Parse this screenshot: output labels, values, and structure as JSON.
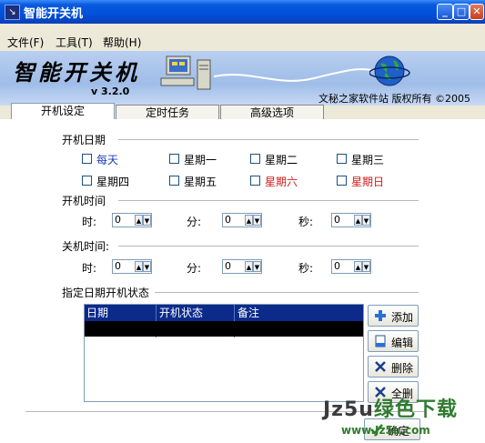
{
  "window": {
    "title": "智能开关机",
    "icon_glyph": "↘",
    "buttons": {
      "min": "_",
      "max": "□",
      "close": "✕"
    }
  },
  "menu": [
    {
      "label": "文件(F)"
    },
    {
      "label": "工具(T)"
    },
    {
      "label": "帮助(H)"
    }
  ],
  "banner": {
    "logo": "智能开关机",
    "version": "v 3.2.0",
    "company": "文秘之家软件站  版权所有  ©2005"
  },
  "tabs": [
    {
      "label": "开机设定",
      "active": true
    },
    {
      "label": "定时任务",
      "active": false
    },
    {
      "label": "高级选项",
      "active": false
    }
  ],
  "startup_days": {
    "label": "开机日期",
    "days": [
      {
        "label": "每天",
        "color": "#1f3fb0"
      },
      {
        "label": "星期一",
        "color": "#000000"
      },
      {
        "label": "星期二",
        "color": "#000000"
      },
      {
        "label": "星期三",
        "color": "#000000"
      },
      {
        "label": "星期四",
        "color": "#000000"
      },
      {
        "label": "星期五",
        "color": "#000000"
      },
      {
        "label": "星期六",
        "color": "#d41a1a"
      },
      {
        "label": "星期日",
        "color": "#d41a1a"
      }
    ]
  },
  "startup_time": {
    "label": "开机时间",
    "hour_label": "时:",
    "minute_label": "分:",
    "second_label": "秒:",
    "hour": "0",
    "minute": "0",
    "second": "0"
  },
  "shutdown_time": {
    "label": "关机时间:",
    "hour_label": "时:",
    "minute_label": "分:",
    "second_label": "秒:",
    "hour": "0",
    "minute": "0",
    "second": "0"
  },
  "schedule": {
    "label": "指定日期开机状态",
    "columns": [
      "日期",
      "开机状态",
      "备注"
    ]
  },
  "side_buttons": {
    "add": "添加",
    "edit": "编辑",
    "delete": "删除",
    "delete_all": "全删"
  },
  "ok_button": "确定",
  "watermark": {
    "main": "Jz5u",
    "green": "绿色下载",
    "sub": "www.Jz5u.com"
  }
}
